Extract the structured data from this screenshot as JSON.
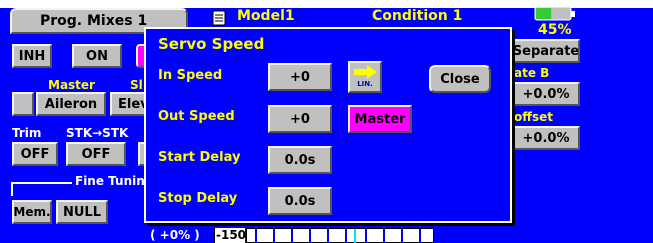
{
  "tab": {
    "label": "Prog. Mixes 1"
  },
  "model": {
    "name": "Model1",
    "condition": "Condition 1"
  },
  "battery": {
    "percent": "45%",
    "level": 0.45
  },
  "mix": {
    "inh": "INH",
    "on": "ON",
    "master_label": "Master",
    "slave_label": "Sl",
    "master_value": "Aileron",
    "slave_value": "Elev",
    "trim_label": "Trim",
    "stk_label": "STK→STK",
    "trim_value": "OFF",
    "stk_value": "OFF",
    "fine_tuning_label": "Fine Tuning",
    "mem": "Mem.",
    "null": "NULL"
  },
  "right_panel": {
    "separate": "Separate",
    "rate_b_label": "ate B",
    "rate_b_value": "+0.0%",
    "offset_label": "offset",
    "offset_value": "+0.0%"
  },
  "bottom": {
    "readout": "( +0% )",
    "scale_label": "-150"
  },
  "dialog": {
    "title": "Servo Speed",
    "in_speed_label": "In Speed",
    "in_speed_value": "+0",
    "out_speed_label": "Out Speed",
    "out_speed_value": "+0",
    "start_delay_label": "Start Delay",
    "start_delay_value": "0.0s",
    "stop_delay_label": "Stop Delay",
    "stop_delay_value": "0.0s",
    "curve_button_text": "LIN.",
    "close": "Close",
    "master": "Master"
  },
  "colors": {
    "background": "#0000ff",
    "label": "#ffff00",
    "button": "#c0c0c0",
    "accent": "#ff00ff",
    "battery": "#33cc33"
  }
}
